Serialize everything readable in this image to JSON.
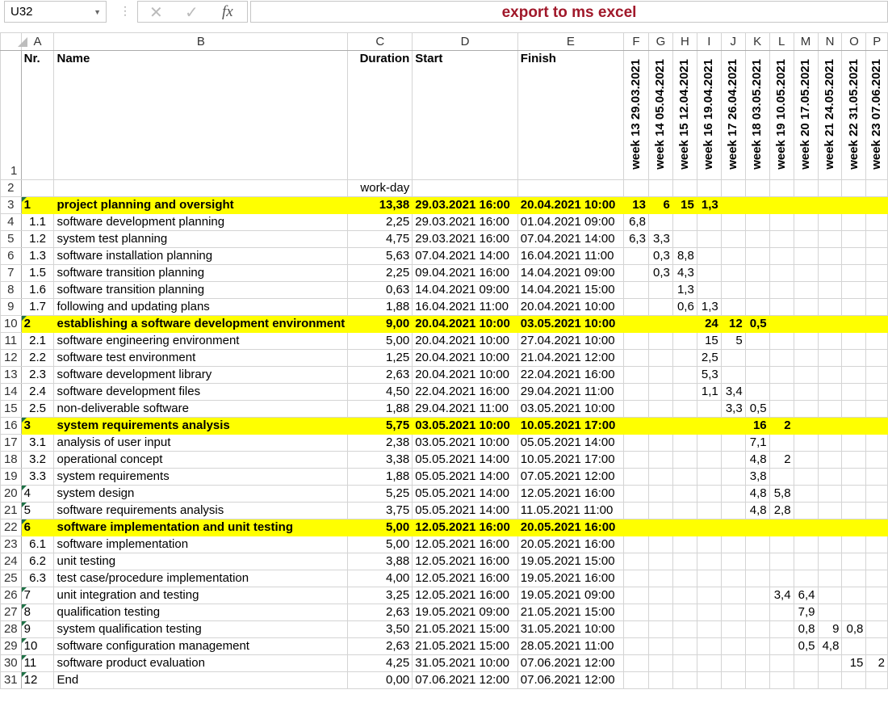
{
  "name_box": "U32",
  "formula_bar": "export to ms excel",
  "icons": {
    "cancel": "x-icon",
    "enter": "check-icon",
    "function": "fx-icon"
  },
  "columns": [
    "A",
    "B",
    "C",
    "D",
    "E",
    "F",
    "G",
    "H",
    "I",
    "J",
    "K",
    "L",
    "M",
    "N",
    "O",
    "P"
  ],
  "header": {
    "nr": "Nr.",
    "name": "Name",
    "duration": "Duration",
    "start": "Start",
    "finish": "Finish",
    "weeks": [
      "week 13 29.03.2021",
      "week 14 05.04.2021",
      "week 15 12.04.2021",
      "week 16 19.04.2021",
      "week 17 26.04.2021",
      "week 18 03.05.2021",
      "week 19 10.05.2021",
      "week 20 17.05.2021",
      "week 21 24.05.2021",
      "week 22 31.05.2021",
      "week 23 07.06.2021"
    ]
  },
  "row2": {
    "duration_unit": "work-day"
  },
  "highlight_color": "#ffff00",
  "rows": [
    {
      "nr": "1",
      "name": "project planning and oversight",
      "duration": "13,38",
      "start": "29.03.2021 16:00",
      "finish": "20.04.2021 10:00",
      "weeks": [
        "13",
        "6",
        "15",
        "1,3",
        "",
        "",
        "",
        "",
        "",
        "",
        ""
      ],
      "summary": true,
      "text_flag": true
    },
    {
      "nr": "1.1",
      "name": "software development planning",
      "duration": "2,25",
      "start": "29.03.2021 16:00",
      "finish": "01.04.2021 09:00",
      "weeks": [
        "6,8",
        "",
        "",
        "",
        "",
        "",
        "",
        "",
        "",
        "",
        ""
      ]
    },
    {
      "nr": "1.2",
      "name": "system test planning",
      "duration": "4,75",
      "start": "29.03.2021 16:00",
      "finish": "07.04.2021 14:00",
      "weeks": [
        "6,3",
        "3,3",
        "",
        "",
        "",
        "",
        "",
        "",
        "",
        "",
        ""
      ]
    },
    {
      "nr": "1.3",
      "name": "software installation planning",
      "duration": "5,63",
      "start": "07.04.2021 14:00",
      "finish": "16.04.2021 11:00",
      "weeks": [
        "",
        "0,3",
        "8,8",
        "",
        "",
        "",
        "",
        "",
        "",
        "",
        ""
      ]
    },
    {
      "nr": "1.5",
      "name": "software transition planning",
      "duration": "2,25",
      "start": "09.04.2021 16:00",
      "finish": "14.04.2021 09:00",
      "weeks": [
        "",
        "0,3",
        "4,3",
        "",
        "",
        "",
        "",
        "",
        "",
        "",
        ""
      ]
    },
    {
      "nr": "1.6",
      "name": "software transition planning",
      "duration": "0,63",
      "start": "14.04.2021 09:00",
      "finish": "14.04.2021 15:00",
      "weeks": [
        "",
        "",
        "1,3",
        "",
        "",
        "",
        "",
        "",
        "",
        "",
        ""
      ]
    },
    {
      "nr": "1.7",
      "name": "following and updating plans",
      "duration": "1,88",
      "start": "16.04.2021 11:00",
      "finish": "20.04.2021 10:00",
      "weeks": [
        "",
        "",
        "0,6",
        "1,3",
        "",
        "",
        "",
        "",
        "",
        "",
        ""
      ]
    },
    {
      "nr": "2",
      "name": "establishing a software development environment",
      "duration": "9,00",
      "start": "20.04.2021 10:00",
      "finish": "03.05.2021 10:00",
      "weeks": [
        "",
        "",
        "",
        "24",
        "12",
        "0,5",
        "",
        "",
        "",
        "",
        ""
      ],
      "summary": true,
      "text_flag": true
    },
    {
      "nr": "2.1",
      "name": "software engineering environment",
      "duration": "5,00",
      "start": "20.04.2021 10:00",
      "finish": "27.04.2021 10:00",
      "weeks": [
        "",
        "",
        "",
        "15",
        "5",
        "",
        "",
        "",
        "",
        "",
        ""
      ]
    },
    {
      "nr": "2.2",
      "name": "software test environment",
      "duration": "1,25",
      "start": "20.04.2021 10:00",
      "finish": "21.04.2021 12:00",
      "weeks": [
        "",
        "",
        "",
        "2,5",
        "",
        "",
        "",
        "",
        "",
        "",
        ""
      ]
    },
    {
      "nr": "2.3",
      "name": "software development library",
      "duration": "2,63",
      "start": "20.04.2021 10:00",
      "finish": "22.04.2021 16:00",
      "weeks": [
        "",
        "",
        "",
        "5,3",
        "",
        "",
        "",
        "",
        "",
        "",
        ""
      ]
    },
    {
      "nr": "2.4",
      "name": "software development files",
      "duration": "4,50",
      "start": "22.04.2021 16:00",
      "finish": "29.04.2021 11:00",
      "weeks": [
        "",
        "",
        "",
        "1,1",
        "3,4",
        "",
        "",
        "",
        "",
        "",
        ""
      ]
    },
    {
      "nr": "2.5",
      "name": "non-deliverable software",
      "duration": "1,88",
      "start": "29.04.2021 11:00",
      "finish": "03.05.2021 10:00",
      "weeks": [
        "",
        "",
        "",
        "",
        "3,3",
        "0,5",
        "",
        "",
        "",
        "",
        ""
      ]
    },
    {
      "nr": "3",
      "name": "system requirements analysis",
      "duration": "5,75",
      "start": "03.05.2021 10:00",
      "finish": "10.05.2021 17:00",
      "weeks": [
        "",
        "",
        "",
        "",
        "",
        "16",
        "2",
        "",
        "",
        "",
        ""
      ],
      "summary": true,
      "text_flag": true
    },
    {
      "nr": "3.1",
      "name": "analysis of user input",
      "duration": "2,38",
      "start": "03.05.2021 10:00",
      "finish": "05.05.2021 14:00",
      "weeks": [
        "",
        "",
        "",
        "",
        "",
        "7,1",
        "",
        "",
        "",
        "",
        ""
      ]
    },
    {
      "nr": "3.2",
      "name": "operational concept",
      "duration": "3,38",
      "start": "05.05.2021 14:00",
      "finish": "10.05.2021 17:00",
      "weeks": [
        "",
        "",
        "",
        "",
        "",
        "4,8",
        "2",
        "",
        "",
        "",
        ""
      ]
    },
    {
      "nr": "3.3",
      "name": "system requirements",
      "duration": "1,88",
      "start": "05.05.2021 14:00",
      "finish": "07.05.2021 12:00",
      "weeks": [
        "",
        "",
        "",
        "",
        "",
        "3,8",
        "",
        "",
        "",
        "",
        ""
      ]
    },
    {
      "nr": "4",
      "name": "system design",
      "duration": "5,25",
      "start": "05.05.2021 14:00",
      "finish": "12.05.2021 16:00",
      "weeks": [
        "",
        "",
        "",
        "",
        "",
        "4,8",
        "5,8",
        "",
        "",
        "",
        ""
      ],
      "text_flag": true
    },
    {
      "nr": "5",
      "name": "software requirements analysis",
      "duration": "3,75",
      "start": "05.05.2021 14:00",
      "finish": "11.05.2021 11:00",
      "weeks": [
        "",
        "",
        "",
        "",
        "",
        "4,8",
        "2,8",
        "",
        "",
        "",
        ""
      ],
      "text_flag": true
    },
    {
      "nr": "6",
      "name": "software implementation and unit testing",
      "duration": "5,00",
      "start": "12.05.2021 16:00",
      "finish": "20.05.2021 16:00",
      "weeks": [
        "",
        "",
        "",
        "",
        "",
        "",
        "",
        "",
        "",
        "",
        ""
      ],
      "summary": true,
      "text_flag": true
    },
    {
      "nr": "6.1",
      "name": "software implementation",
      "duration": "5,00",
      "start": "12.05.2021 16:00",
      "finish": "20.05.2021 16:00",
      "weeks": [
        "",
        "",
        "",
        "",
        "",
        "",
        "",
        "",
        "",
        "",
        ""
      ]
    },
    {
      "nr": "6.2",
      "name": "unit testing",
      "duration": "3,88",
      "start": "12.05.2021 16:00",
      "finish": "19.05.2021 15:00",
      "weeks": [
        "",
        "",
        "",
        "",
        "",
        "",
        "",
        "",
        "",
        "",
        ""
      ]
    },
    {
      "nr": "6.3",
      "name": "test case/procedure implementation",
      "duration": "4,00",
      "start": "12.05.2021 16:00",
      "finish": "19.05.2021 16:00",
      "weeks": [
        "",
        "",
        "",
        "",
        "",
        "",
        "",
        "",
        "",
        "",
        ""
      ]
    },
    {
      "nr": "7",
      "name": "unit integration and testing",
      "duration": "3,25",
      "start": "12.05.2021 16:00",
      "finish": "19.05.2021 09:00",
      "weeks": [
        "",
        "",
        "",
        "",
        "",
        "",
        "3,4",
        "6,4",
        "",
        "",
        ""
      ],
      "text_flag": true
    },
    {
      "nr": "8",
      "name": "qualification testing",
      "duration": "2,63",
      "start": "19.05.2021 09:00",
      "finish": "21.05.2021 15:00",
      "weeks": [
        "",
        "",
        "",
        "",
        "",
        "",
        "",
        "7,9",
        "",
        "",
        ""
      ],
      "text_flag": true
    },
    {
      "nr": "9",
      "name": "system qualification testing",
      "duration": "3,50",
      "start": "21.05.2021 15:00",
      "finish": "31.05.2021 10:00",
      "weeks": [
        "",
        "",
        "",
        "",
        "",
        "",
        "",
        "0,8",
        "9",
        "0,8",
        ""
      ],
      "text_flag": true
    },
    {
      "nr": "10",
      "name": "software configuration management",
      "duration": "2,63",
      "start": "21.05.2021 15:00",
      "finish": "28.05.2021 11:00",
      "weeks": [
        "",
        "",
        "",
        "",
        "",
        "",
        "",
        "0,5",
        "4,8",
        "",
        ""
      ],
      "text_flag": true
    },
    {
      "nr": "11",
      "name": "software product evaluation",
      "duration": "4,25",
      "start": "31.05.2021 10:00",
      "finish": "07.06.2021 12:00",
      "weeks": [
        "",
        "",
        "",
        "",
        "",
        "",
        "",
        "",
        "",
        "15",
        "2"
      ],
      "text_flag": true
    },
    {
      "nr": "12",
      "name": "End",
      "duration": "0,00",
      "start": "07.06.2021 12:00",
      "finish": "07.06.2021 12:00",
      "weeks": [
        "",
        "",
        "",
        "",
        "",
        "",
        "",
        "",
        "",
        "",
        ""
      ],
      "text_flag": true
    }
  ]
}
